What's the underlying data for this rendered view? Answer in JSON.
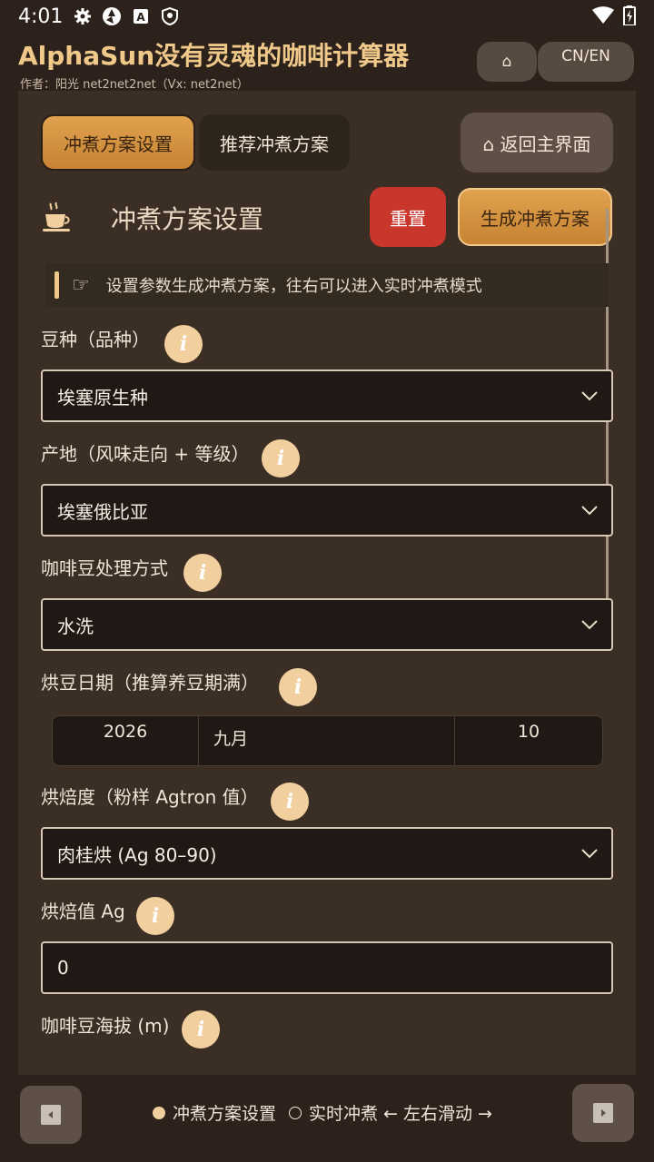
{
  "status_bar": {
    "time": "4:01"
  },
  "header": {
    "title": "AlphaSun没有灵魂的咖啡计算器",
    "author": "作者：阳光 net2net2net（Vx: net2net）",
    "home_label": "⌂",
    "lang_label": "CN/EN"
  },
  "tabs": [
    {
      "label": "冲煮方案设置",
      "active": true
    },
    {
      "label": "推荐冲煮方案",
      "active": false
    }
  ],
  "back_main_label": "⌂ 返回主界面",
  "section": {
    "title": "冲煮方案设置",
    "reset_label": "重置",
    "generate_label": "生成冲煮方案",
    "hint": "设置参数生成冲煮方案，往右可以进入实时冲煮模式"
  },
  "fields": {
    "variety": {
      "label": "豆种（品种）",
      "value": "埃塞原生种"
    },
    "origin": {
      "label": "产地（风味走向 + 等级）",
      "value": "埃塞俄比亚"
    },
    "process": {
      "label": "咖啡豆处理方式",
      "value": "水洗"
    },
    "roast_date": {
      "label": "烘豆日期（推算养豆期满）",
      "year": "2026",
      "month": "九月",
      "day": "10"
    },
    "roast_level": {
      "label": "烘焙度（粉样 Agtron 值）",
      "value": "肉桂烘 (Ag 80–90)"
    },
    "roast_ag": {
      "label": "烘焙值 Ag",
      "value": "0"
    },
    "altitude": {
      "label": "咖啡豆海拔 (m)"
    }
  },
  "info_glyph": "i",
  "footer": {
    "page1": "冲煮方案设置",
    "page2": "实时冲煮",
    "swipe_hint": "← 左右滑动 →"
  },
  "colors": {
    "accent": "#e0a24e",
    "danger": "#c9372c",
    "background": "#2d221b",
    "panel": "#3a2e25"
  }
}
